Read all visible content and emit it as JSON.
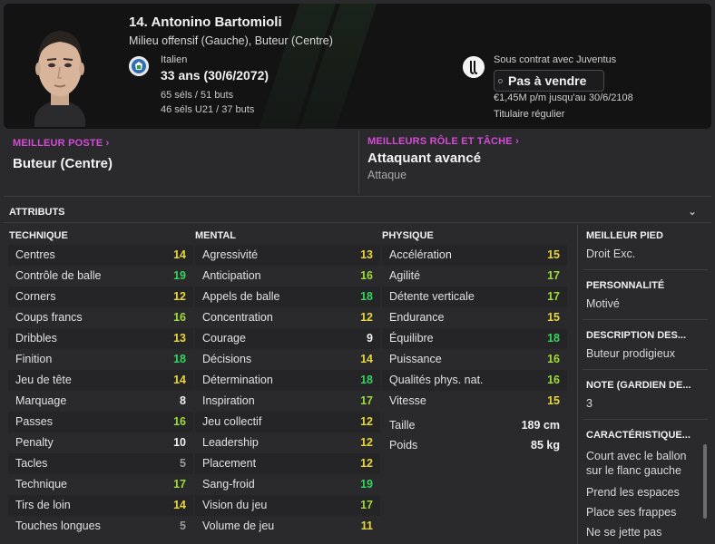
{
  "header": {
    "name": "14. Antonino Bartomioli",
    "positions": "Milieu offensif (Gauche), Buteur (Centre)",
    "nationality": "Italien",
    "age": "33 ans (30/6/2072)",
    "caps": "65 séls / 51 buts",
    "caps_u21": "46 séls U21 / 37 buts",
    "contract_label": "Sous contrat avec Juventus",
    "transfer_status": "Pas à vendre",
    "wage": "€1,45M p/m jusqu'au 30/6/2108",
    "squad_role": "Titulaire régulier",
    "icons": [
      "italy-flag-icon",
      "juventus-badge-icon"
    ]
  },
  "best_position": {
    "label": "MEILLEUR POSTE",
    "value": "Buteur (Centre)"
  },
  "best_role": {
    "label": "MEILLEURS RÔLE ET TÂCHE",
    "value": "Attaquant avancé",
    "duty": "Attaque"
  },
  "attributes": {
    "title": "ATTRIBUTS",
    "technique": {
      "heading": "TECHNIQUE",
      "items": [
        {
          "label": "Centres",
          "value": "14",
          "tier": "yellow"
        },
        {
          "label": "Contrôle de balle",
          "value": "19",
          "tier": "green"
        },
        {
          "label": "Corners",
          "value": "12",
          "tier": "yellow"
        },
        {
          "label": "Coups francs",
          "value": "16",
          "tier": "lgreen"
        },
        {
          "label": "Dribbles",
          "value": "13",
          "tier": "yellow"
        },
        {
          "label": "Finition",
          "value": "18",
          "tier": "green"
        },
        {
          "label": "Jeu de tête",
          "value": "14",
          "tier": "yellow"
        },
        {
          "label": "Marquage",
          "value": "8",
          "tier": "white"
        },
        {
          "label": "Passes",
          "value": "16",
          "tier": "lgreen"
        },
        {
          "label": "Penalty",
          "value": "10",
          "tier": "white"
        },
        {
          "label": "Tacles",
          "value": "5",
          "tier": "dim"
        },
        {
          "label": "Technique",
          "value": "17",
          "tier": "lgreen"
        },
        {
          "label": "Tirs de loin",
          "value": "14",
          "tier": "yellow"
        },
        {
          "label": "Touches longues",
          "value": "5",
          "tier": "dim"
        }
      ]
    },
    "mental": {
      "heading": "MENTAL",
      "items": [
        {
          "label": "Agressivité",
          "value": "13",
          "tier": "yellow"
        },
        {
          "label": "Anticipation",
          "value": "16",
          "tier": "lgreen"
        },
        {
          "label": "Appels de balle",
          "value": "18",
          "tier": "green"
        },
        {
          "label": "Concentration",
          "value": "12",
          "tier": "yellow"
        },
        {
          "label": "Courage",
          "value": "9",
          "tier": "white"
        },
        {
          "label": "Décisions",
          "value": "14",
          "tier": "yellow"
        },
        {
          "label": "Détermination",
          "value": "18",
          "tier": "green"
        },
        {
          "label": "Inspiration",
          "value": "17",
          "tier": "lgreen"
        },
        {
          "label": "Jeu collectif",
          "value": "12",
          "tier": "yellow"
        },
        {
          "label": "Leadership",
          "value": "12",
          "tier": "yellow"
        },
        {
          "label": "Placement",
          "value": "12",
          "tier": "yellow"
        },
        {
          "label": "Sang-froid",
          "value": "19",
          "tier": "green"
        },
        {
          "label": "Vision du jeu",
          "value": "17",
          "tier": "lgreen"
        },
        {
          "label": "Volume de jeu",
          "value": "11",
          "tier": "yellow"
        }
      ]
    },
    "physique": {
      "heading": "PHYSIQUE",
      "items": [
        {
          "label": "Accélération",
          "value": "15",
          "tier": "yellow"
        },
        {
          "label": "Agilité",
          "value": "17",
          "tier": "lgreen"
        },
        {
          "label": "Détente verticale",
          "value": "17",
          "tier": "lgreen"
        },
        {
          "label": "Endurance",
          "value": "15",
          "tier": "yellow"
        },
        {
          "label": "Équilibre",
          "value": "18",
          "tier": "green"
        },
        {
          "label": "Puissance",
          "value": "16",
          "tier": "lgreen"
        },
        {
          "label": "Qualités phys. nat.",
          "value": "16",
          "tier": "lgreen"
        },
        {
          "label": "Vitesse",
          "value": "15",
          "tier": "yellow"
        }
      ],
      "height_label": "Taille",
      "height_value": "189 cm",
      "weight_label": "Poids",
      "weight_value": "85 kg"
    }
  },
  "side_panel": {
    "foot_label": "MEILLEUR PIED",
    "foot_value": "Droit Exc.",
    "personality_label": "PERSONNALITÉ",
    "personality_value": "Motivé",
    "description_label": "DESCRIPTION DES...",
    "description_value": "Buteur prodigieux",
    "gk_label": "NOTE (GARDIEN DE...",
    "gk_value": "3",
    "traits_label": "CARACTÉRISTIQUE...",
    "traits": [
      "Court avec le ballon sur le flanc gauche",
      "Prend les espaces",
      "Place ses frappes",
      "Ne se jette pas"
    ]
  }
}
